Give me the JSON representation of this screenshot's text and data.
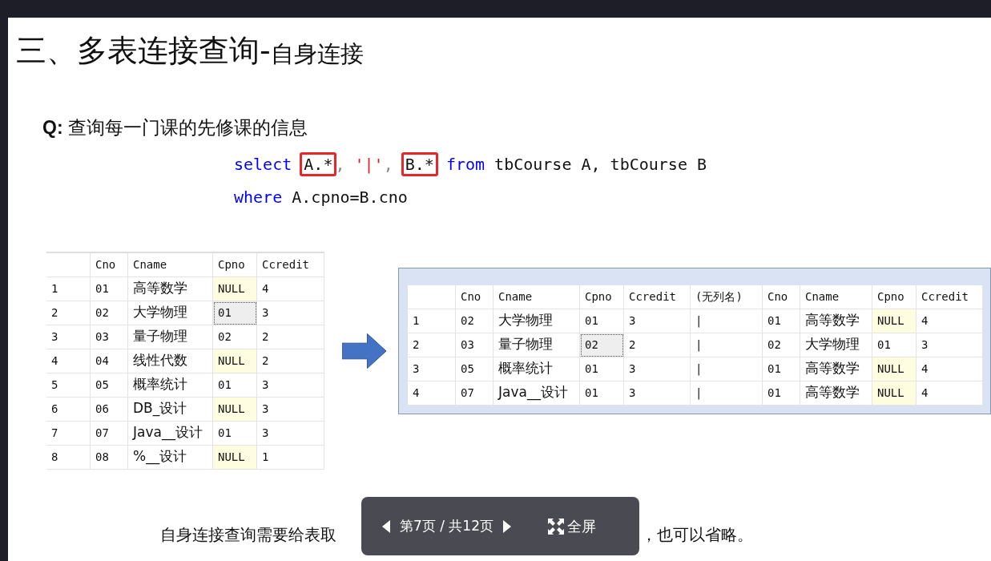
{
  "title": {
    "main": "三、多表连接查询-",
    "sub": "自身连接"
  },
  "question": {
    "label": "Q:",
    "text": "查询每一门课的先修课的信息"
  },
  "code": [
    {
      "tokens": [
        {
          "text": "select ",
          "kind": "keyword"
        },
        {
          "text": "A.*",
          "kind": "boxed"
        },
        {
          "text": ", ",
          "kind": "punct"
        },
        {
          "text": "'|'",
          "kind": "string"
        },
        {
          "text": ", ",
          "kind": "punct"
        },
        {
          "text": "B.*",
          "kind": "boxed"
        },
        {
          "text": " from",
          "kind": "keyword"
        },
        {
          "text": " tbCourse A, tbCourse B",
          "kind": "plain"
        }
      ]
    },
    {
      "tokens": [
        {
          "text": "where",
          "kind": "keyword"
        },
        {
          "text": " A.cpno=B.cno",
          "kind": "plain"
        }
      ]
    }
  ],
  "source_table": {
    "columns": [
      "",
      "Cno",
      "Cname",
      "Cpno",
      "Ccredit"
    ],
    "rows": [
      [
        {
          "text": "1",
          "kind": "value"
        },
        {
          "text": "01",
          "kind": "value"
        },
        {
          "text": "高等数学",
          "kind": "value"
        },
        {
          "text": "NULL",
          "kind": "null"
        },
        {
          "text": "4",
          "kind": "value"
        }
      ],
      [
        {
          "text": "2",
          "kind": "value"
        },
        {
          "text": "02",
          "kind": "value"
        },
        {
          "text": "大学物理",
          "kind": "value"
        },
        {
          "text": "01",
          "kind": "focused"
        },
        {
          "text": "3",
          "kind": "value"
        }
      ],
      [
        {
          "text": "3",
          "kind": "value"
        },
        {
          "text": "03",
          "kind": "value"
        },
        {
          "text": "量子物理",
          "kind": "value"
        },
        {
          "text": "02",
          "kind": "value"
        },
        {
          "text": "2",
          "kind": "value"
        }
      ],
      [
        {
          "text": "4",
          "kind": "value"
        },
        {
          "text": "04",
          "kind": "value"
        },
        {
          "text": "线性代数",
          "kind": "value"
        },
        {
          "text": "NULL",
          "kind": "null"
        },
        {
          "text": "2",
          "kind": "value"
        }
      ],
      [
        {
          "text": "5",
          "kind": "value"
        },
        {
          "text": "05",
          "kind": "value"
        },
        {
          "text": "概率统计",
          "kind": "value"
        },
        {
          "text": "01",
          "kind": "value"
        },
        {
          "text": "3",
          "kind": "value"
        }
      ],
      [
        {
          "text": "6",
          "kind": "value"
        },
        {
          "text": "06",
          "kind": "value"
        },
        {
          "text": "DB_设计",
          "kind": "value"
        },
        {
          "text": "NULL",
          "kind": "null"
        },
        {
          "text": "3",
          "kind": "value"
        }
      ],
      [
        {
          "text": "7",
          "kind": "value"
        },
        {
          "text": "07",
          "kind": "value"
        },
        {
          "text": "Java__设计",
          "kind": "value"
        },
        {
          "text": "01",
          "kind": "value"
        },
        {
          "text": "3",
          "kind": "value"
        }
      ],
      [
        {
          "text": "8",
          "kind": "value"
        },
        {
          "text": "08",
          "kind": "value"
        },
        {
          "text": "%__设计",
          "kind": "value"
        },
        {
          "text": "NULL",
          "kind": "null"
        },
        {
          "text": "1",
          "kind": "value"
        }
      ]
    ]
  },
  "result_table": {
    "columns": [
      "",
      "Cno",
      "Cname",
      "Cpno",
      "Ccredit",
      "(无列名)",
      "Cno",
      "Cname",
      "Cpno",
      "Ccredit"
    ],
    "rows": [
      [
        {
          "text": "1",
          "kind": "value"
        },
        {
          "text": "02",
          "kind": "value"
        },
        {
          "text": "大学物理",
          "kind": "value"
        },
        {
          "text": "01",
          "kind": "value"
        },
        {
          "text": "3",
          "kind": "value"
        },
        {
          "text": "|",
          "kind": "value"
        },
        {
          "text": "01",
          "kind": "value"
        },
        {
          "text": "高等数学",
          "kind": "value"
        },
        {
          "text": "NULL",
          "kind": "null"
        },
        {
          "text": "4",
          "kind": "value"
        }
      ],
      [
        {
          "text": "2",
          "kind": "value"
        },
        {
          "text": "03",
          "kind": "value"
        },
        {
          "text": "量子物理",
          "kind": "value"
        },
        {
          "text": "02",
          "kind": "focused"
        },
        {
          "text": "2",
          "kind": "value"
        },
        {
          "text": "|",
          "kind": "value"
        },
        {
          "text": "02",
          "kind": "value"
        },
        {
          "text": "大学物理",
          "kind": "value"
        },
        {
          "text": "01",
          "kind": "value"
        },
        {
          "text": "3",
          "kind": "value"
        }
      ],
      [
        {
          "text": "3",
          "kind": "value"
        },
        {
          "text": "05",
          "kind": "value"
        },
        {
          "text": "概率统计",
          "kind": "value"
        },
        {
          "text": "01",
          "kind": "value"
        },
        {
          "text": "3",
          "kind": "value"
        },
        {
          "text": "|",
          "kind": "value"
        },
        {
          "text": "01",
          "kind": "value"
        },
        {
          "text": "高等数学",
          "kind": "value"
        },
        {
          "text": "NULL",
          "kind": "null"
        },
        {
          "text": "4",
          "kind": "value"
        }
      ],
      [
        {
          "text": "4",
          "kind": "value"
        },
        {
          "text": "07",
          "kind": "value"
        },
        {
          "text": "Java__设计",
          "kind": "value"
        },
        {
          "text": "01",
          "kind": "value"
        },
        {
          "text": "3",
          "kind": "value"
        },
        {
          "text": "|",
          "kind": "value"
        },
        {
          "text": "01",
          "kind": "value"
        },
        {
          "text": "高等数学",
          "kind": "value"
        },
        {
          "text": "NULL",
          "kind": "null"
        },
        {
          "text": "4",
          "kind": "value"
        }
      ]
    ]
  },
  "note": [
    "自身连接查询需要给表取",
    "，也可以省略。"
  ],
  "pager": {
    "page_label": "第7页 / 共12页",
    "fullscreen_label": "全屏"
  }
}
